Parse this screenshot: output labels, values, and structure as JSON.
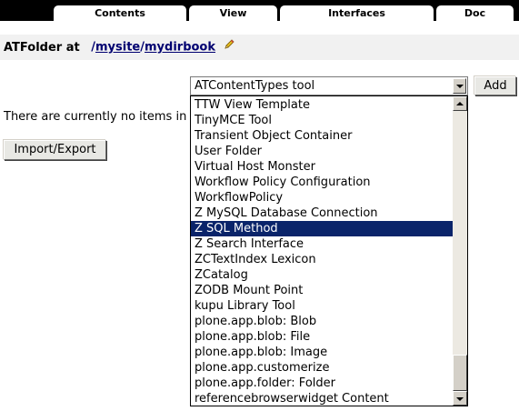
{
  "tabs": [
    {
      "label": "Contents"
    },
    {
      "label": "View"
    },
    {
      "label": "Interfaces"
    },
    {
      "label": "Doc"
    }
  ],
  "header": {
    "lead": "ATFolder at",
    "path_sep": "/",
    "path_root": "mysite",
    "path_current": "mydirbook",
    "edit_icon": "pencil-icon"
  },
  "add_select": {
    "selected": "ATContentTypes tool"
  },
  "add_button": "Add",
  "empty_message": "There are currently no items in",
  "import_export_button": "Import/Export",
  "dropdown": {
    "highlighted_index": 8,
    "options": [
      "TTW View Template",
      "TinyMCE Tool",
      "Transient Object Container",
      "User Folder",
      "Virtual Host Monster",
      "Workflow Policy Configuration",
      "WorkflowPolicy",
      "Z MySQL Database Connection",
      "Z SQL Method",
      "Z Search Interface",
      "ZCTextIndex Lexicon",
      "ZCatalog",
      "ZODB Mount Point",
      "kupu Library Tool",
      "plone.app.blob: Blob",
      "plone.app.blob: File",
      "plone.app.blob: Image",
      "plone.app.customerize",
      "plone.app.folder: Folder",
      "referencebrowserwidget Content"
    ]
  },
  "colors": {
    "highlight": "#0a246a",
    "link": "#000070",
    "tabbar": "#000000"
  }
}
